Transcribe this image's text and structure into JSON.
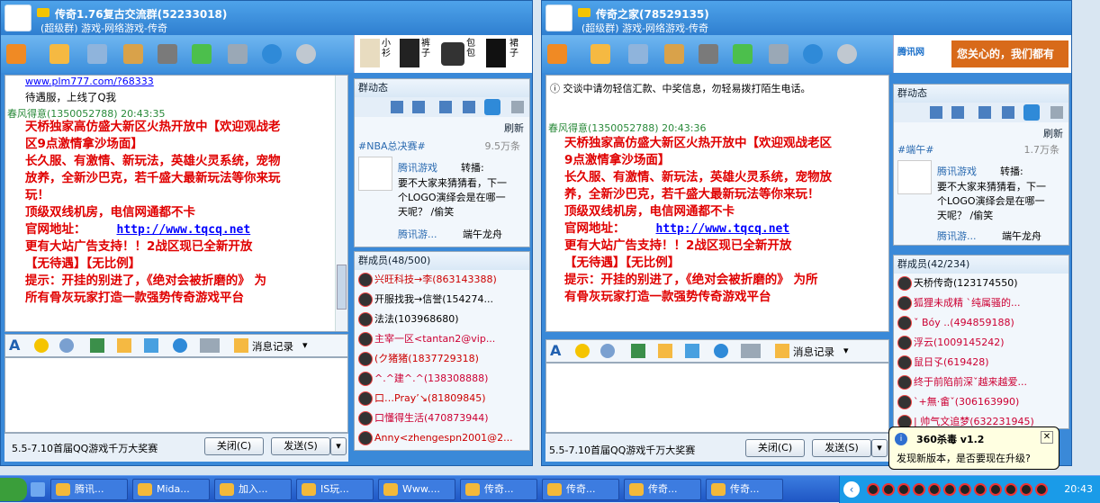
{
  "window1": {
    "title": "传奇1.76复古交流群(52233018)",
    "subtitle": "(超级群) 游戏-网络游戏-传奇",
    "ad_items": [
      "小衫",
      "裤子",
      "包包",
      "裙子"
    ],
    "chat_top_link": "www.plm777.com/?68333",
    "chat_top_text": "待遇服，上线了Q我",
    "sender": "春风得意(1350052788)  20:43:35",
    "message_lines": [
      "天桥独家高仿盛大新区火热开放中【欢迎观战老",
      "区9点激情拿沙场面】",
      "长久服、有激情、新玩法，英雄火灵系统，宠物",
      "放养，全新沙巴克，若千盛大最新玩法等你来玩",
      "玩！",
      "顶级双线机房，电信网通都不卡",
      "官网地址：",
      "更有大站广告支持！！2战区现已全新开放",
      "【无待遇】【无比例】",
      "提示：开挂的别进了，《绝对会被折磨的》 为",
      "所有骨灰玩家打造一款强势传奇游戏平台"
    ],
    "url": "http://www.tqcq.net",
    "history_label": "消息记录",
    "promo": "5.5-7.10首届QQ游戏千万大奖赛",
    "close_label": "关闭(C)",
    "send_label": "发送(S)",
    "group_dynamic": "群动态",
    "refresh": "刷新",
    "topic": "#NBA总决赛#",
    "topic_count": "9.5万条",
    "feed_name": "腾讯游戏",
    "feed_action": "转播:",
    "feed_text": "要不大家来猜猜看，下一个LOGO演绎会是在哪一天呢？ /偷笑",
    "feed_name2": "腾讯游...",
    "feed_text2": "端午龙舟",
    "members_title": "群成员(48/500)",
    "members": [
      "兴旺科技→李(863143388)",
      "开服找我→信誉(154274...",
      "法法(103968680)",
      "主宰一区<tantan2@vip...",
      "(ク猪猪(1837729318)",
      "^.^建^.^(138308888)",
      "口…Pray’↘(81809845)",
      "口懂得生活(470873944)",
      "Anny<zhengespn2001@2..."
    ]
  },
  "window2": {
    "title": "传奇之家(78529135)",
    "subtitle": "(超级群) 游戏-网络游戏-传奇",
    "ad_text": "您关心的，我们都有",
    "ad_logo": "腾讯网",
    "notice": "交谈中请勿轻信汇款、中奖信息，勿轻易拨打陌生电话。",
    "sender": "春风得意(1350052788)  20:43:36",
    "message_lines": [
      "天桥独家高仿盛大新区火热开放中【欢迎观战老区",
      "9点激情拿沙场面】",
      "长久服、有激情、新玩法，英雄火灵系统，宠物放",
      "养，全新沙巴克，若千盛大最新玩法等你来玩！",
      "顶级双线机房，电信网通都不卡",
      "官网地址：",
      "更有大站广告支持！！2战区现已全新开放",
      "【无待遇】【无比例】",
      "提示：开挂的别进了，《绝对会被折磨的》 为所",
      "有骨灰玩家打造一款强势传奇游戏平台"
    ],
    "url": "http://www.tqcq.net",
    "history_label": "消息记录",
    "promo": "5.5-7.10首届QQ游戏千万大奖赛",
    "close_label": "关闭(C)",
    "send_label": "发送(S)",
    "group_dynamic": "群动态",
    "refresh": "刷新",
    "topic": "#端午#",
    "topic_count": "1.7万条",
    "feed_name": "腾讯游戏",
    "feed_action": "转播:",
    "feed_text": "要不大家来猜猜看，下一个LOGO演绎会是在哪一天呢？ /偷笑",
    "feed_name2": "腾讯游...",
    "feed_text2": "端午龙舟",
    "members_title": "群成员(42/234)",
    "members": [
      "天桥传奇(123174550)",
      "狐狸未成精 ˋ纯属骚的...",
      "ˇ Bóy ..(494859188)",
      "浮云(1009145242)",
      "鼠日孓(619428)",
      "终于前陷前深ˇ越来越爱...",
      "ˋ+無·畲ˇ(306163990)",
      "| 帅气文追梦(632231945)"
    ]
  },
  "balloon": {
    "title": "360杀毒 v1.2",
    "text": "发现新版本，是否要现在升级?"
  },
  "taskbar": {
    "items": [
      "腾讯...",
      "Mida...",
      "加入...",
      "IS玩...",
      "Www....",
      "传奇...",
      "传奇...",
      "传奇...",
      "传奇..."
    ],
    "clock": "20:43"
  }
}
